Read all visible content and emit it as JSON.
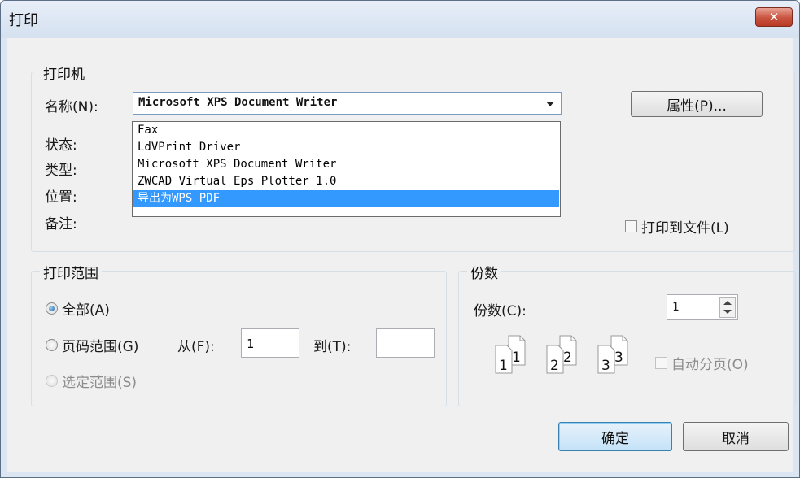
{
  "window": {
    "title": "打印",
    "close_icon": "close-icon"
  },
  "printer": {
    "group_title": "打印机",
    "name_label": "名称(N):",
    "selected": "Microsoft XPS Document Writer",
    "options": [
      "Fax",
      "LdVPrint Driver",
      "Microsoft XPS Document Writer",
      "ZWCAD Virtual Eps Plotter 1.0",
      "导出为WPS PDF"
    ],
    "highlighted_option": "导出为WPS PDF",
    "status_label": "状态:",
    "type_label": "类型:",
    "location_label": "位置:",
    "comment_label": "备注:",
    "properties_button": "属性(P)...",
    "print_to_file_label": "打印到文件(L)",
    "print_to_file_checked": false
  },
  "range": {
    "group_title": "打印范围",
    "all_label": "全部(A)",
    "pages_label": "页码范围(G)",
    "from_label": "从(F):",
    "from_value": "1",
    "to_label": "到(T):",
    "to_value": "",
    "selection_label": "选定范围(S)",
    "selected_option": "all"
  },
  "copies": {
    "group_title": "份数",
    "count_label": "份数(C):",
    "count_value": "1",
    "collate_label": "自动分页(O)",
    "collate_checked": false,
    "collate_icons": [
      [
        "1",
        "1"
      ],
      [
        "2",
        "2"
      ],
      [
        "3",
        "3"
      ]
    ]
  },
  "buttons": {
    "ok": "确定",
    "cancel": "取消"
  },
  "colors": {
    "selection": "#3399ff",
    "titlebar": "#dce6f3",
    "close": "#c9533f"
  }
}
